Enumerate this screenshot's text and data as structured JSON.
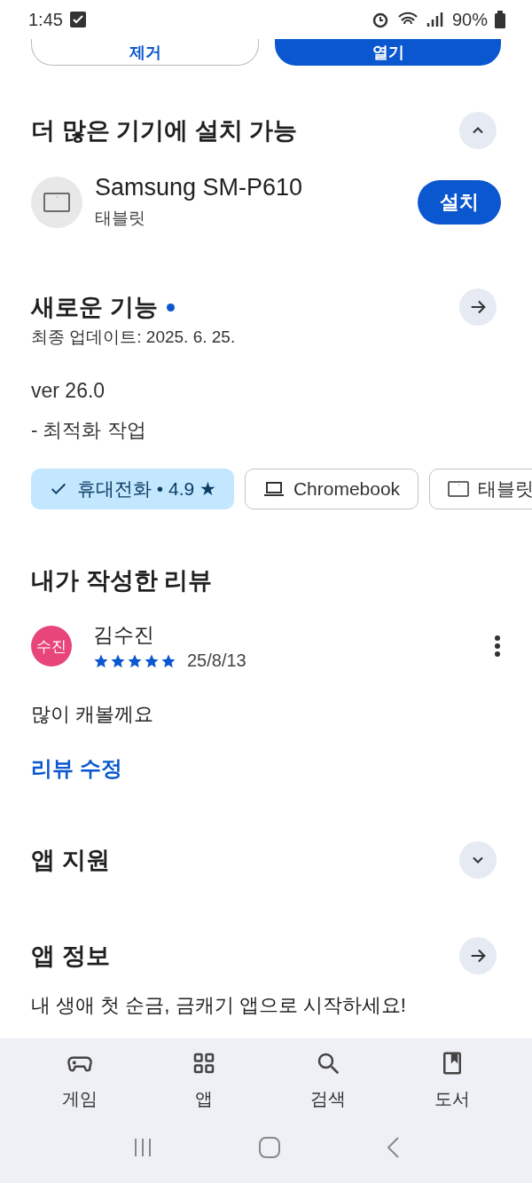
{
  "status_bar": {
    "time": "1:45",
    "battery": "90%"
  },
  "top_buttons": [
    {
      "label": "제거",
      "kind": "outline"
    },
    {
      "label": "열기",
      "kind": "filled"
    }
  ],
  "install_section": {
    "title": "더 많은 기기에 설치 가능",
    "expanded": true,
    "device": {
      "name": "Samsung SM-P610",
      "type": "태블릿",
      "button": "설치"
    }
  },
  "whats_new": {
    "title": "새로운 기능",
    "updated": "최종 업데이트: 2025. 6. 25.",
    "version": "ver 26.0",
    "notes": "- 최적화 작업"
  },
  "chips": [
    {
      "label": "휴대전화 • 4.9 ★",
      "kind": "phone",
      "selected": true
    },
    {
      "label": "Chromebook",
      "kind": "laptop",
      "selected": false
    },
    {
      "label": "태블릿",
      "kind": "tablet",
      "selected": false
    }
  ],
  "my_review": {
    "title": "내가 작성한 리뷰",
    "avatar": "수진",
    "name": "김수진",
    "stars": 5,
    "date": "25/8/13",
    "text": "많이 캐볼께요",
    "edit_link": "리뷰 수정"
  },
  "app_support": {
    "title": "앱 지원",
    "expanded": false
  },
  "app_info": {
    "title": "앱 정보",
    "description": "내 생애 첫 순금, 금캐기 앱으로 시작하세요!"
  },
  "bottom_nav": [
    {
      "label": "게임",
      "kind": "games"
    },
    {
      "label": "앱",
      "kind": "apps"
    },
    {
      "label": "검색",
      "kind": "search"
    },
    {
      "label": "도서",
      "kind": "books"
    }
  ]
}
